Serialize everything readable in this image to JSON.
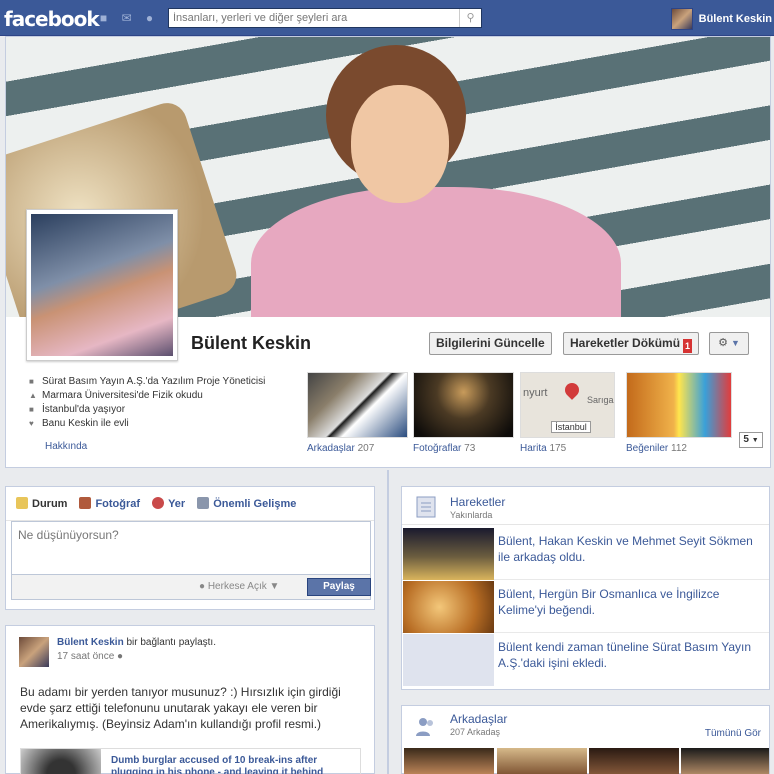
{
  "topbar": {
    "logo": "facebook",
    "search_placeholder": "İnsanları, yerleri ve diğer şeyleri ara",
    "user_name": "Bülent Keskin"
  },
  "profile": {
    "name": "Bülent Keskin",
    "update_info_label": "Bilgilerini Güncelle",
    "activity_log_label": "Hareketler Dökümü",
    "activity_log_badge": "1",
    "info": [
      "Sürat Basım Yayın A.Ş.'da Yazılım Proje Yöneticisi",
      "Marmara Üniversitesi'de Fizik okudu",
      "İstanbul'da yaşıyor",
      "Banu Keskin ile evli"
    ],
    "about_label": "Hakkında",
    "tiles": [
      {
        "label": "Arkadaşlar",
        "count": "207"
      },
      {
        "label": "Fotoğraflar",
        "count": "73"
      },
      {
        "label": "Harita",
        "count": "175"
      },
      {
        "label": "Beğeniler",
        "count": "112"
      }
    ],
    "map_text": "İstanbul",
    "map_corner": "Sarıgaz",
    "map_left": "nyurt",
    "more_count": "5"
  },
  "composer": {
    "tabs": [
      "Durum",
      "Fotoğraf",
      "Yer",
      "Önemli Gelişme"
    ],
    "placeholder": "Ne düşünüyorsun?",
    "privacy": "Herkese Açık",
    "share_label": "Paylaş"
  },
  "post": {
    "author": "Bülent Keskin",
    "action": "bir bağlantı paylaştı.",
    "time": "17 saat önce",
    "body": "Bu adamı bir yerden tanıyor musunuz? :) Hırsızlık için girdiği evde şarz ettiği telefonunu unutarak yakayı ele veren bir Amerikalıymış. (Beyinsiz Adam'ın kullandığı profil resmi.)",
    "link_title": "Dumb burglar accused of 10 break-ins after plugging in his phone - and leaving it behind"
  },
  "activity": {
    "title": "Hareketler",
    "subtitle": "Yakınlarda",
    "items": [
      "Bülent, Hakan Keskin ve Mehmet Seyit Sökmen ile arkadaş oldu.",
      "Bülent, Hergün Bir Osmanlıca ve İngilizce Kelime'yi beğendi.",
      "Bülent kendi zaman tüneline Sürat Basım Yayın A.Ş.'daki işini ekledi."
    ]
  },
  "friends": {
    "title": "Arkadaşlar",
    "subtitle": "207 Arkadaş",
    "see_all": "Tümünü Gör"
  },
  "colors": {
    "brand": "#3b5998",
    "badge": "#d63333",
    "share": "#5b74a8"
  }
}
